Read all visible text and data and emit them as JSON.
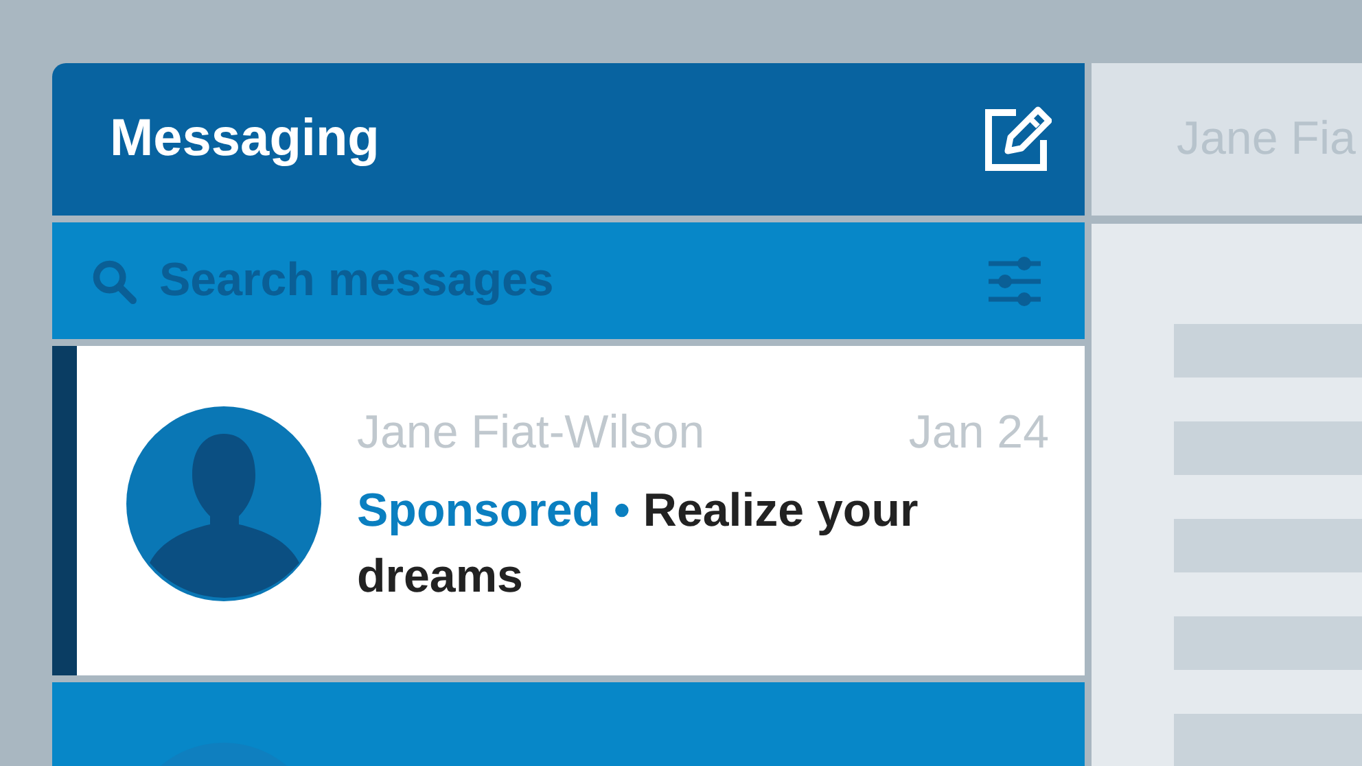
{
  "messaging": {
    "title": "Messaging",
    "search": {
      "placeholder": "Search messages"
    },
    "conversations": [
      {
        "name": "Jane Fiat-Wilson",
        "date": "Jan 24",
        "tag": "Sponsored",
        "separator": "•",
        "message": "Realize your dreams",
        "selected": true
      },
      {
        "selected": false
      }
    ]
  },
  "detail": {
    "title": "Jane Fia"
  }
}
